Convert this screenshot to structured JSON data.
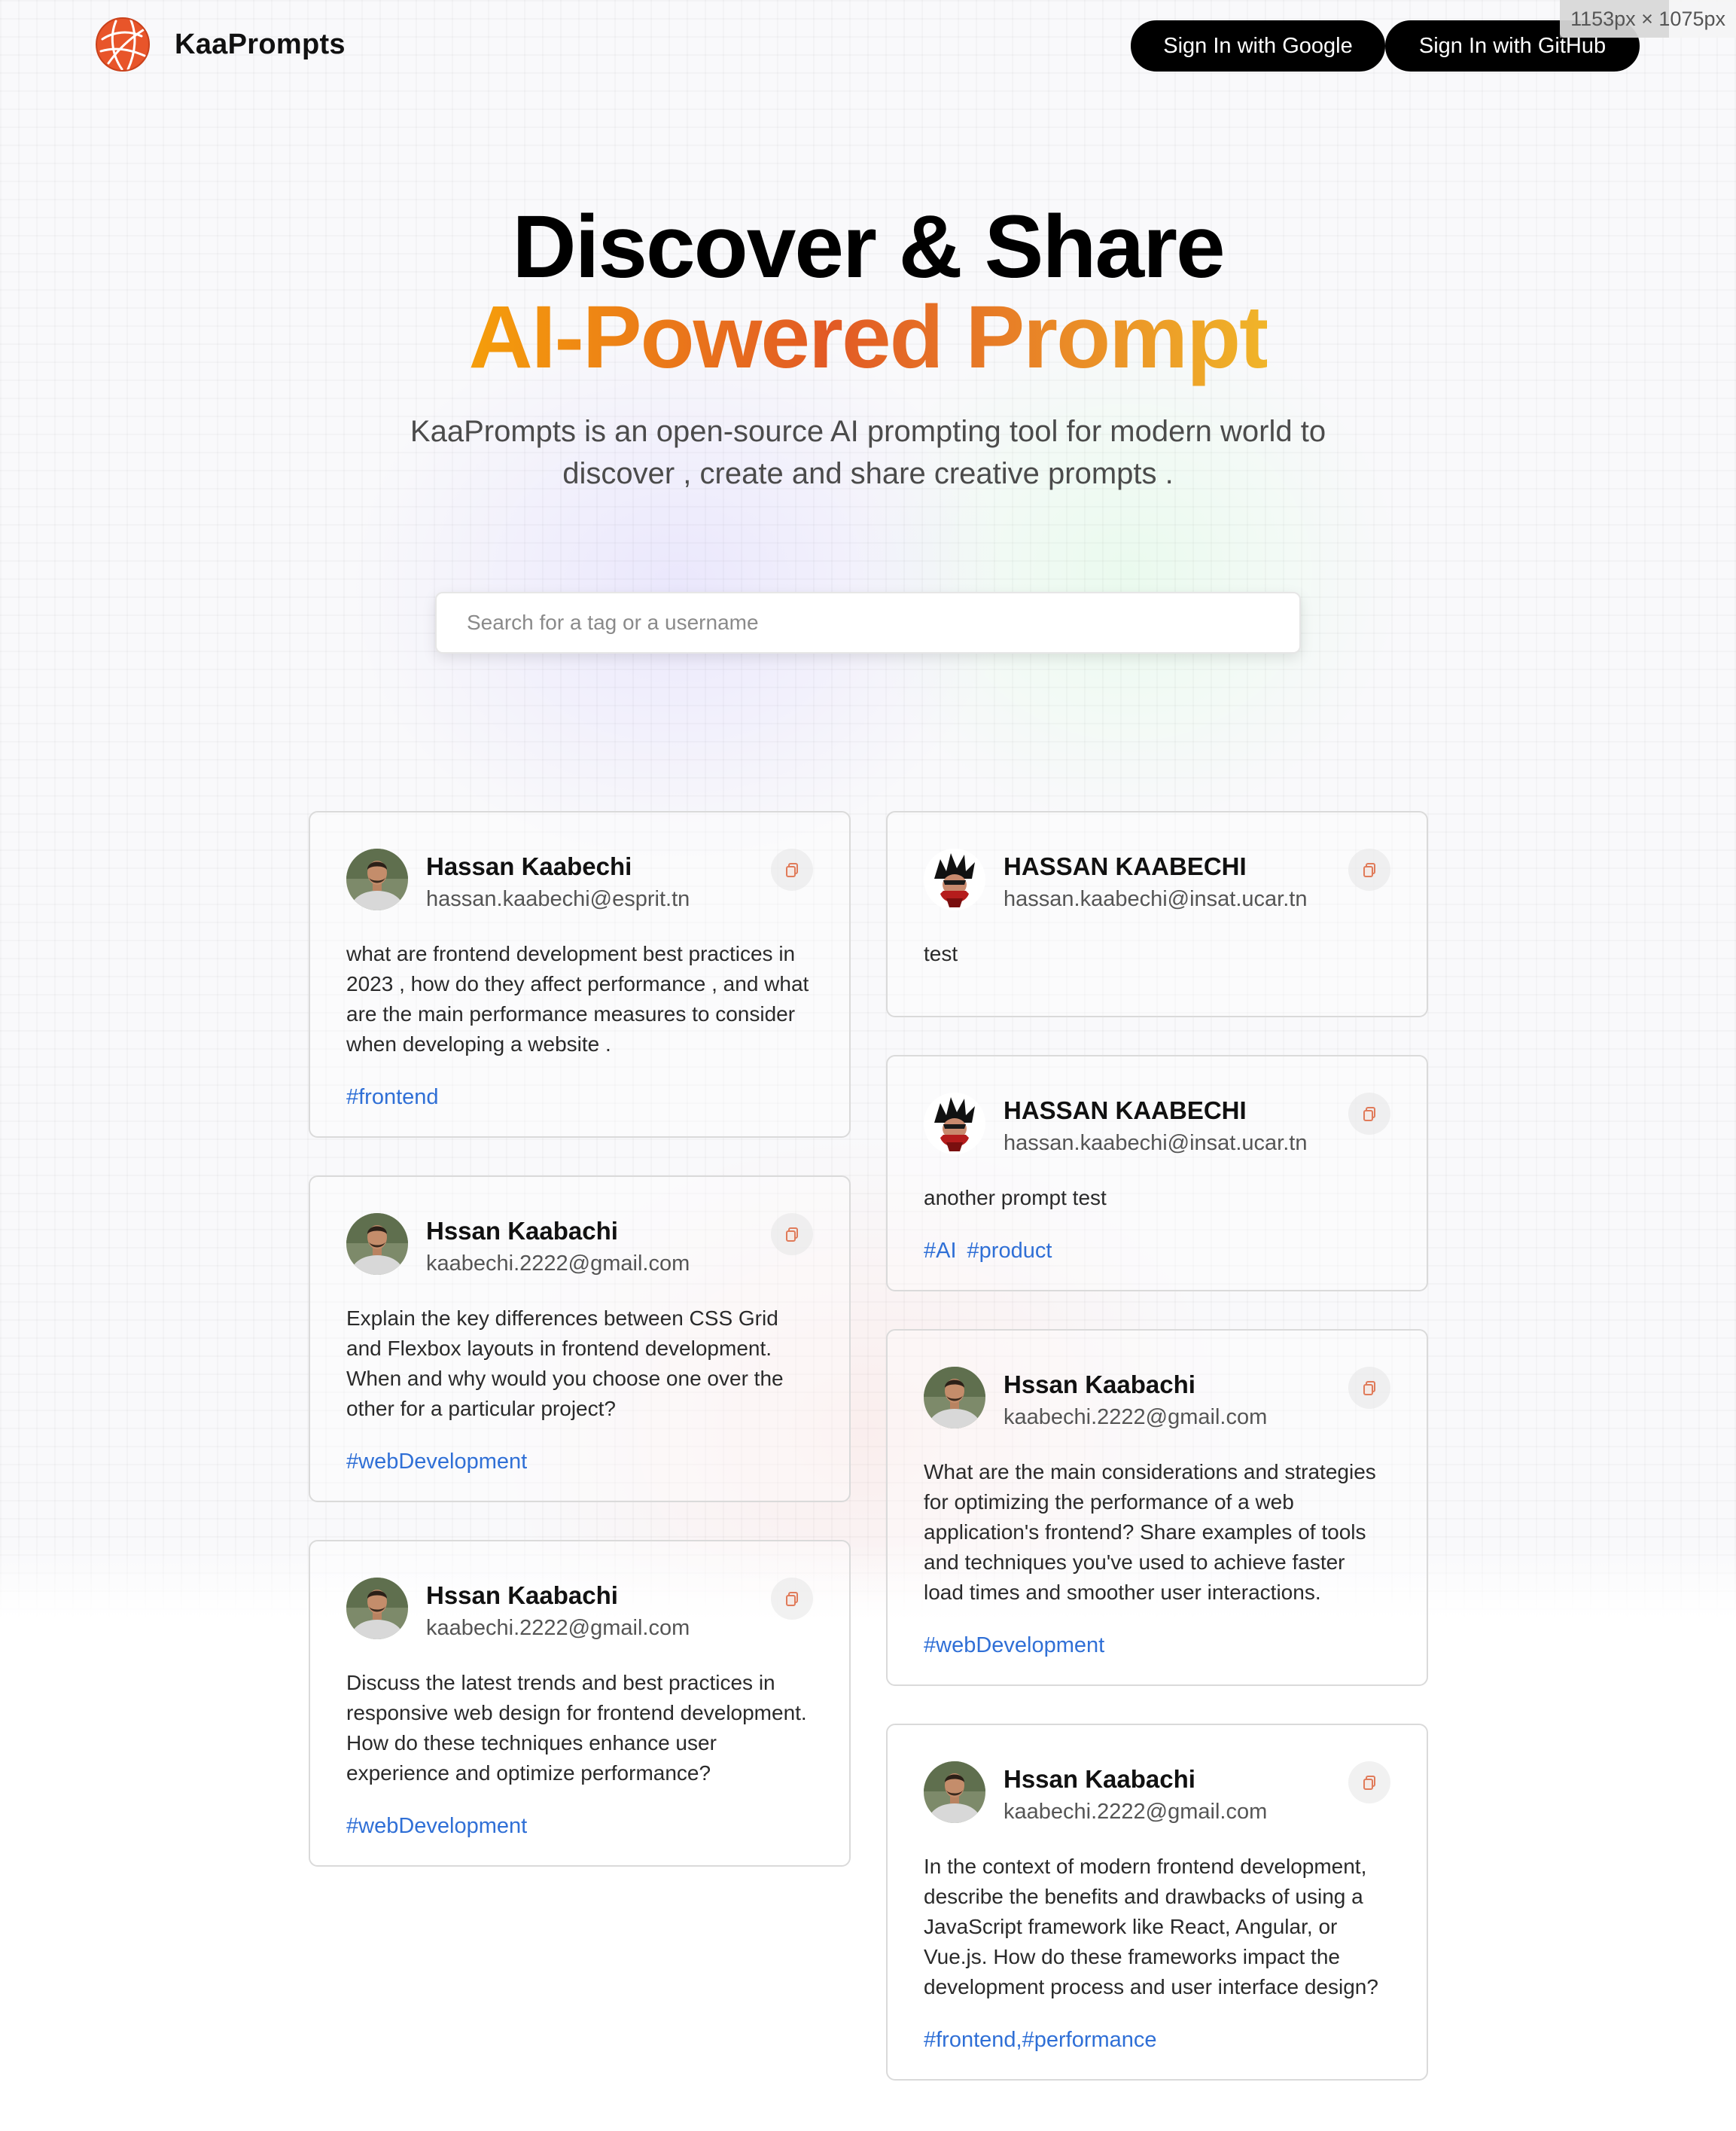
{
  "header": {
    "brand": "KaaPrompts",
    "google_button": "Sign In with Google",
    "github_button": "Sign In with GitHub",
    "dimension_badge": "1153px × 1075px"
  },
  "hero": {
    "title_line1": "Discover & Share",
    "title_line2": "AI-Powered Prompt",
    "description": "KaaPrompts is an open-source AI prompting tool for modern world to discover , create and share creative prompts ."
  },
  "search": {
    "placeholder": "Search for a tag or a username",
    "value": ""
  },
  "colors": {
    "accent_orange": "#e25a25",
    "accent_amber": "#f59e0b",
    "tag_blue": "#2f6fd6",
    "button_black": "#000000"
  },
  "cards": [
    {
      "name": "Hassan Kaabechi",
      "email": "hassan.kaabechi@esprit.tn",
      "avatar": "photo-avatar",
      "prompt": "what are frontend development best practices in 2023 , how do they affect performance , and what are the main performance measures to consider when developing a website .",
      "tags": [
        "#frontend"
      ]
    },
    {
      "name": "Hssan Kaabachi",
      "email": "kaabechi.2222@gmail.com",
      "avatar": "photo-avatar",
      "prompt": "Explain the key differences between CSS Grid and Flexbox layouts in frontend development. When and why would you choose one over the other for a particular project?",
      "tags": [
        "#webDevelopment"
      ]
    },
    {
      "name": "Hssan Kaabachi",
      "email": "kaabechi.2222@gmail.com",
      "avatar": "photo-avatar",
      "prompt": "Discuss the latest trends and best practices in responsive web design for frontend development. How do these techniques enhance user experience and optimize performance?",
      "tags": [
        "#webDevelopment"
      ]
    },
    {
      "name": "HASSAN KAABECHI",
      "email": "hassan.kaabechi@insat.ucar.tn",
      "avatar": "anime-avatar",
      "prompt": "test",
      "tags": []
    },
    {
      "name": "HASSAN KAABECHI",
      "email": "hassan.kaabechi@insat.ucar.tn",
      "avatar": "anime-avatar",
      "prompt": "another prompt test",
      "tags": [
        "#AI",
        "#product"
      ]
    },
    {
      "name": "Hssan Kaabachi",
      "email": "kaabechi.2222@gmail.com",
      "avatar": "photo-avatar",
      "prompt": "What are the main considerations and strategies for optimizing the performance of a web application's frontend? Share examples of tools and techniques you've used to achieve faster load times and smoother user interactions.",
      "tags": [
        "#webDevelopment"
      ]
    },
    {
      "name": "Hssan Kaabachi",
      "email": "kaabechi.2222@gmail.com",
      "avatar": "photo-avatar",
      "prompt": "In the context of modern frontend development, describe the benefits and drawbacks of using a JavaScript framework like React, Angular, or Vue.js. How do these frameworks impact the development process and user interface design?",
      "tags": [
        "#frontend,#performance"
      ]
    }
  ]
}
